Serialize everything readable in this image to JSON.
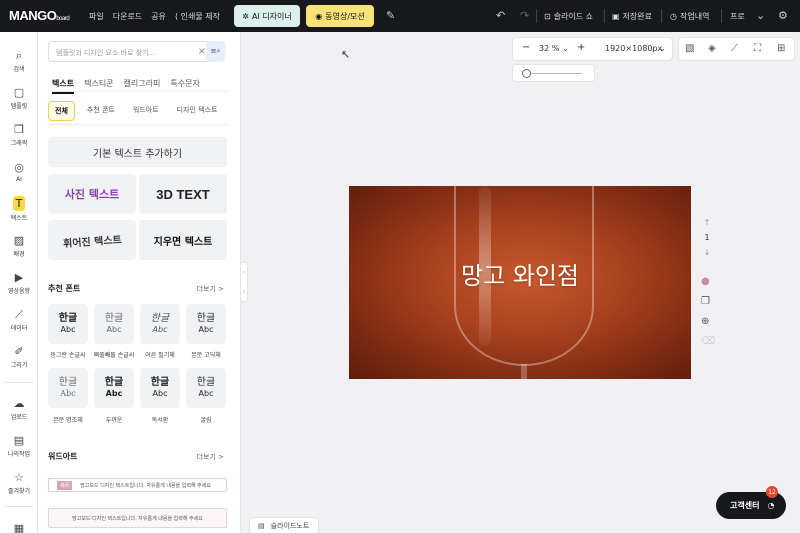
{
  "header": {
    "logo": "MANGO",
    "logo_sub": "board",
    "menu": [
      "파일",
      "다운로드",
      "공유",
      "인쇄물 제작"
    ],
    "ai_designer": "AI 디자이너",
    "video_motion": "동영상/모션",
    "slideshow": "슬라이드 쇼",
    "saved": "저장완료",
    "history": "작업내역",
    "profile": "프로"
  },
  "rail": [
    {
      "label": "검색",
      "icon": "search-icon"
    },
    {
      "label": "템플릿",
      "icon": "template-icon"
    },
    {
      "label": "그래픽",
      "icon": "graphic-icon"
    },
    {
      "label": "AI",
      "icon": "ai-icon"
    },
    {
      "label": "텍스트",
      "icon": "text-icon"
    },
    {
      "label": "배경",
      "icon": "background-icon"
    },
    {
      "label": "영상음향",
      "icon": "media-icon"
    },
    {
      "label": "데이터",
      "icon": "chart-icon"
    },
    {
      "label": "그리기",
      "icon": "draw-icon"
    },
    {
      "label": "업로드",
      "icon": "upload-icon"
    },
    {
      "label": "나의작업",
      "icon": "my-work-icon"
    },
    {
      "label": "즐겨찾기",
      "icon": "favorite-icon"
    }
  ],
  "panel": {
    "search_placeholder": "템플릿과 디자인 요소 바로 찾기...",
    "tabs": [
      "텍스트",
      "텍스티콘",
      "캘리그라피",
      "특수문자"
    ],
    "chips": [
      "전체",
      "추천 폰트",
      "워드아트",
      "디자인 텍스트"
    ],
    "add_basic_text": "기본 텍스트 추가하기",
    "styles": [
      "사진 텍스트",
      "3D TEXT",
      "휘어진 텍스트",
      "지우면 텍스트"
    ],
    "recommended_fonts_title": "추천 폰트",
    "more": "더보기 >",
    "font_sample_k": "한글",
    "font_sample_a": "Abc",
    "fonts": [
      "동그란 손글씨",
      "삐뚤빼뚤 손글씨",
      "어른 필기체",
      "본문 고딕체",
      "본문 명조체",
      "두꺼운",
      "독서환",
      "굴림"
    ],
    "wordart_title": "워드아트",
    "wordart_1_tag": "제목",
    "wordart_1_text": "망고보드 디자인 텍스트입니다. 자유롭게 내용을 입력해 주세요",
    "wordart_2_text": "망고보드 디자인 텍스트입니다. 자유롭게 내용을 입력해 주세요"
  },
  "canvas": {
    "zoom": "32 %",
    "size": "1920×1080px",
    "slide_title": "망고 와인점",
    "page_number": "1",
    "notes": "슬라이드노트"
  },
  "support": {
    "label": "고객센터",
    "badge": "12"
  }
}
